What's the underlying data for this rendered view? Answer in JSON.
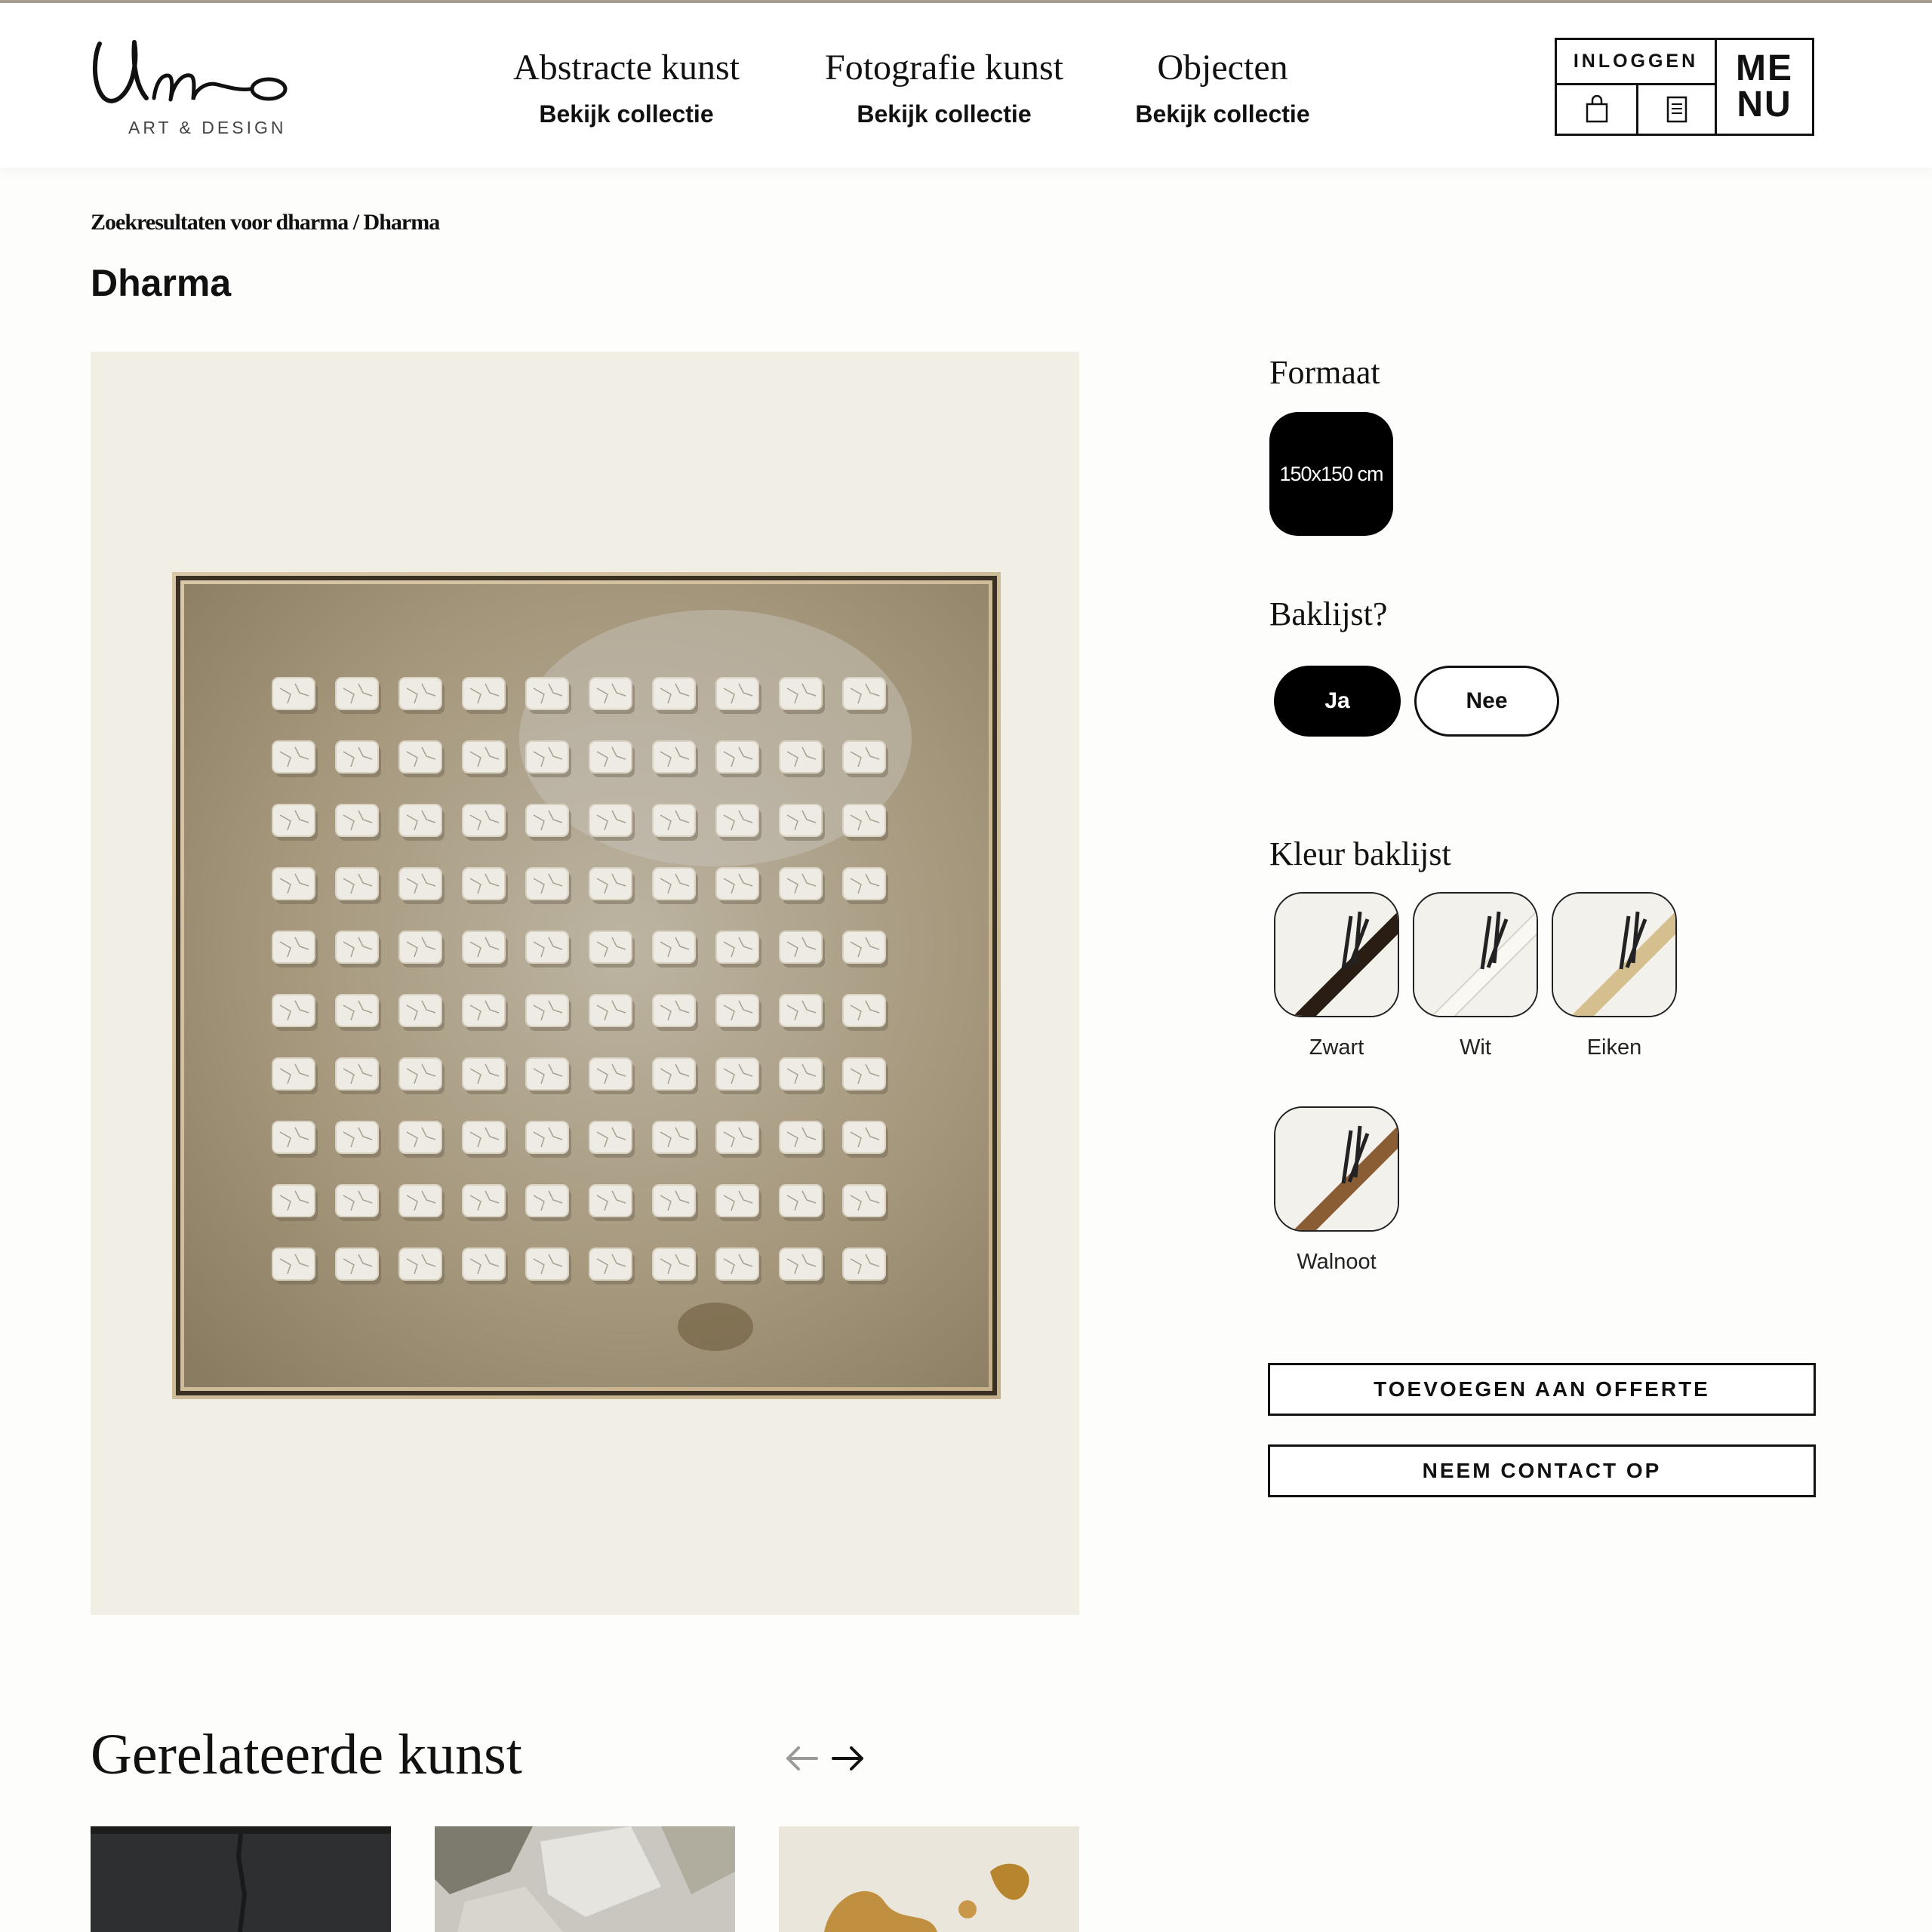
{
  "logo": {
    "script": "Umo",
    "subtitle": "ART & DESIGN"
  },
  "nav": [
    {
      "title": "Abstracte kunst",
      "link": "Bekijk collectie"
    },
    {
      "title": "Fotografie kunst",
      "link": "Bekijk collectie"
    },
    {
      "title": "Objecten",
      "link": "Bekijk collectie"
    }
  ],
  "account": {
    "login": "INLOGGEN",
    "menu_top": "ME",
    "menu_bottom": "NU",
    "cart_icon": "shopping-bag-icon",
    "list_icon": "quote-list-icon"
  },
  "breadcrumb": "Zoekresultaten voor dharma / Dharma",
  "product": {
    "title": "Dharma",
    "image": "artwork-dharma"
  },
  "options": {
    "size_label": "Formaat",
    "size_value": "150x150 cm",
    "frame_label": "Baklijst?",
    "frame_yes": "Ja",
    "frame_no": "Nee",
    "color_label": "Kleur baklijst",
    "colors": [
      {
        "name": "Zwart",
        "hex": "#2a1d14"
      },
      {
        "name": "Wit",
        "hex": "#f1ede4"
      },
      {
        "name": "Eiken",
        "hex": "#d6bf8f"
      },
      {
        "name": "Walnoot",
        "hex": "#8a5d34"
      }
    ]
  },
  "actions": {
    "add_quote": "TOEVOEGEN AAN OFFERTE",
    "contact": "NEEM CONTACT OP"
  },
  "related": {
    "title": "Gerelateerde kunst",
    "prev_icon": "arrow-left-icon",
    "next_icon": "arrow-right-icon"
  }
}
